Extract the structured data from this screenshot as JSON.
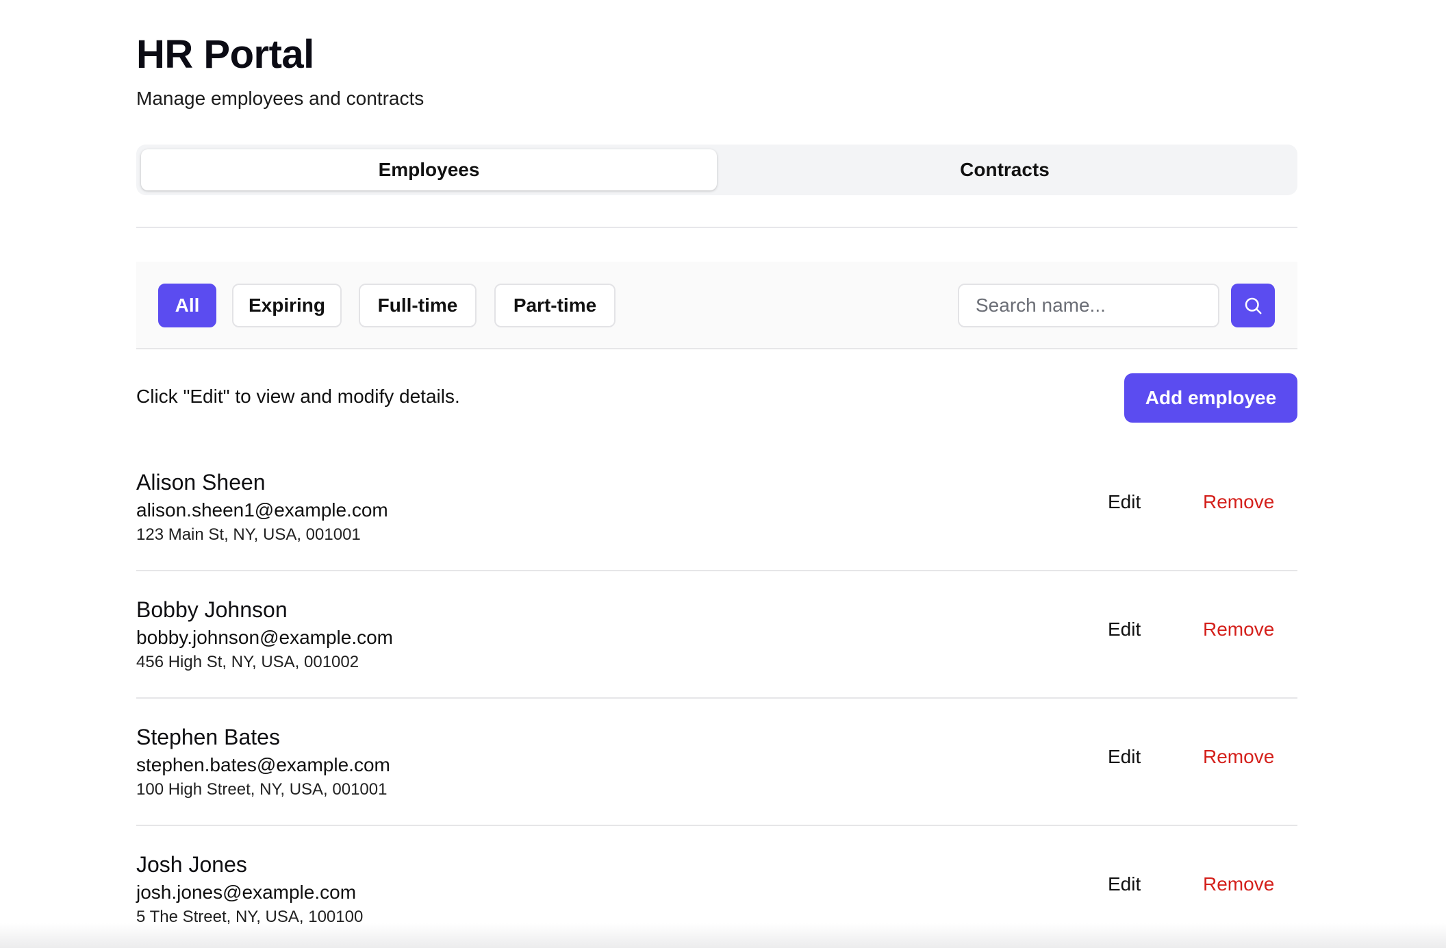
{
  "header": {
    "title": "HR Portal",
    "subtitle": "Manage employees and contracts"
  },
  "tabs": [
    {
      "label": "Employees",
      "active": true
    },
    {
      "label": "Contracts",
      "active": false
    }
  ],
  "filters": {
    "chips": [
      {
        "label": "All",
        "active": true
      },
      {
        "label": "Expiring",
        "active": false
      },
      {
        "label": "Full-time",
        "active": false
      },
      {
        "label": "Part-time",
        "active": false
      }
    ],
    "search": {
      "placeholder": "Search name...",
      "value": ""
    },
    "search_icon": "search-icon"
  },
  "toolbar": {
    "hint": "Click \"Edit\" to view and modify details.",
    "add_label": "Add employee"
  },
  "employees": [
    {
      "name": "Alison Sheen",
      "email": "alison.sheen1@example.com",
      "address": "123 Main St, NY, USA, 001001",
      "edit_label": "Edit",
      "remove_label": "Remove"
    },
    {
      "name": "Bobby Johnson",
      "email": "bobby.johnson@example.com",
      "address": "456 High St, NY, USA, 001002",
      "edit_label": "Edit",
      "remove_label": "Remove"
    },
    {
      "name": "Stephen Bates",
      "email": "stephen.bates@example.com",
      "address": "100 High Street, NY, USA, 001001",
      "edit_label": "Edit",
      "remove_label": "Remove"
    },
    {
      "name": "Josh Jones",
      "email": "josh.jones@example.com",
      "address": "5 The Street, NY, USA, 100100",
      "edit_label": "Edit",
      "remove_label": "Remove"
    }
  ],
  "colors": {
    "accent": "#5b4cf0",
    "danger": "#d4201b",
    "tabs_bg": "#f3f4f6",
    "divider": "#e6e6e8"
  }
}
